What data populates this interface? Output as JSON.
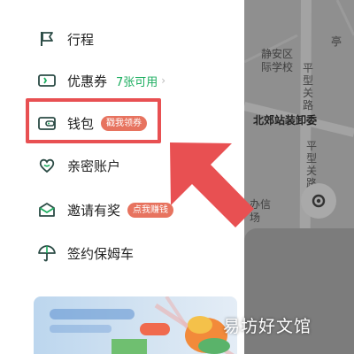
{
  "menu": {
    "items": [
      {
        "label": "行程",
        "icon": "flag-icon"
      },
      {
        "label": "优惠券",
        "sub": "7张可用",
        "icon": "coupon-icon"
      },
      {
        "label": "钱包",
        "badge": "戳我领券",
        "icon": "wallet-icon"
      },
      {
        "label": "亲密账户",
        "icon": "heart-icon"
      },
      {
        "label": "邀请有奖",
        "badge": "点我赚钱",
        "icon": "gift-icon"
      },
      {
        "label": "签约保姆车",
        "icon": "umbrella-icon"
      }
    ]
  },
  "map": {
    "labels": {
      "school": "静安区\n际学校",
      "road1": "平型关路",
      "station": "北郊站装卸委",
      "road2": "平型关路",
      "partial": "办信\n场",
      "edge": "亭"
    }
  },
  "watermark": "易坊好文馆",
  "colors": {
    "accent_green": "#1aad5e",
    "badge_red": "#e7735f",
    "highlight_red": "#e85052",
    "icon_dark": "#2b4b45"
  }
}
